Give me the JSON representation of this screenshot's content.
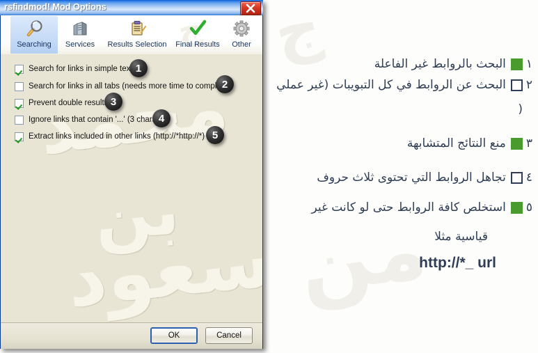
{
  "window": {
    "title": "rsfindmod! Mod Options",
    "close_icon": "close-icon"
  },
  "toolbar": {
    "tabs": [
      {
        "label": "Searching",
        "icon": "magnifier-icon",
        "selected": true
      },
      {
        "label": "Services",
        "icon": "servers-icon",
        "selected": false
      },
      {
        "label": "Results Selection",
        "icon": "clipboard-icon",
        "selected": false
      },
      {
        "label": "Final Results",
        "icon": "green-check-icon",
        "selected": false
      },
      {
        "label": "Other",
        "icon": "gear-icon",
        "selected": false
      }
    ]
  },
  "options": [
    {
      "label": "Search for links in simple texts",
      "checked": true,
      "badge": "1"
    },
    {
      "label": "Search for links in all tabs (needs more time to complete)",
      "checked": false,
      "badge": "2"
    },
    {
      "label": "Prevent double results",
      "checked": true,
      "badge": "3"
    },
    {
      "label": "Ignore links that contain '...' (3 chars)",
      "checked": false,
      "badge": "4"
    },
    {
      "label": "Extract links included in other links (http://*http://*)",
      "checked": true,
      "badge": "5"
    }
  ],
  "footer": {
    "ok_label": "OK",
    "cancel_label": "Cancel"
  },
  "notes": {
    "items": [
      {
        "num": "١",
        "marker": "filled",
        "text": "البحث بالروابط غير الفاعلة"
      },
      {
        "num": "٢",
        "marker": "empty",
        "text": "البحث عن الروابط في كل التبويبات (غير عملي"
      },
      {
        "num": "٣",
        "marker": "filled",
        "text": "منع النتائج المتشابهة"
      },
      {
        "num": "٤",
        "marker": "empty",
        "text": "تجاهل الروابط التي تحتوى ثلاث حروف"
      },
      {
        "num": "٥",
        "marker": "filled",
        "text": "استخلص كافة الروابط حتى لو كانت غير"
      }
    ],
    "continuation_2": "(",
    "continuation_5": "قياسية مثلا",
    "url_example": "http://*_ url"
  },
  "watermark": {
    "panel_1": "محمد",
    "panel_2": "بن",
    "panel_3": "سعود",
    "right_1": "ج",
    "right_2": "من"
  },
  "colors": {
    "title_gradient_start": "#0c5ad4",
    "panel_bg": "#e9e5d5",
    "note_green": "#4a9b2e",
    "note_text": "#2e3d55",
    "check_green": "#1f9a1f",
    "close_red": "#d93b25"
  }
}
